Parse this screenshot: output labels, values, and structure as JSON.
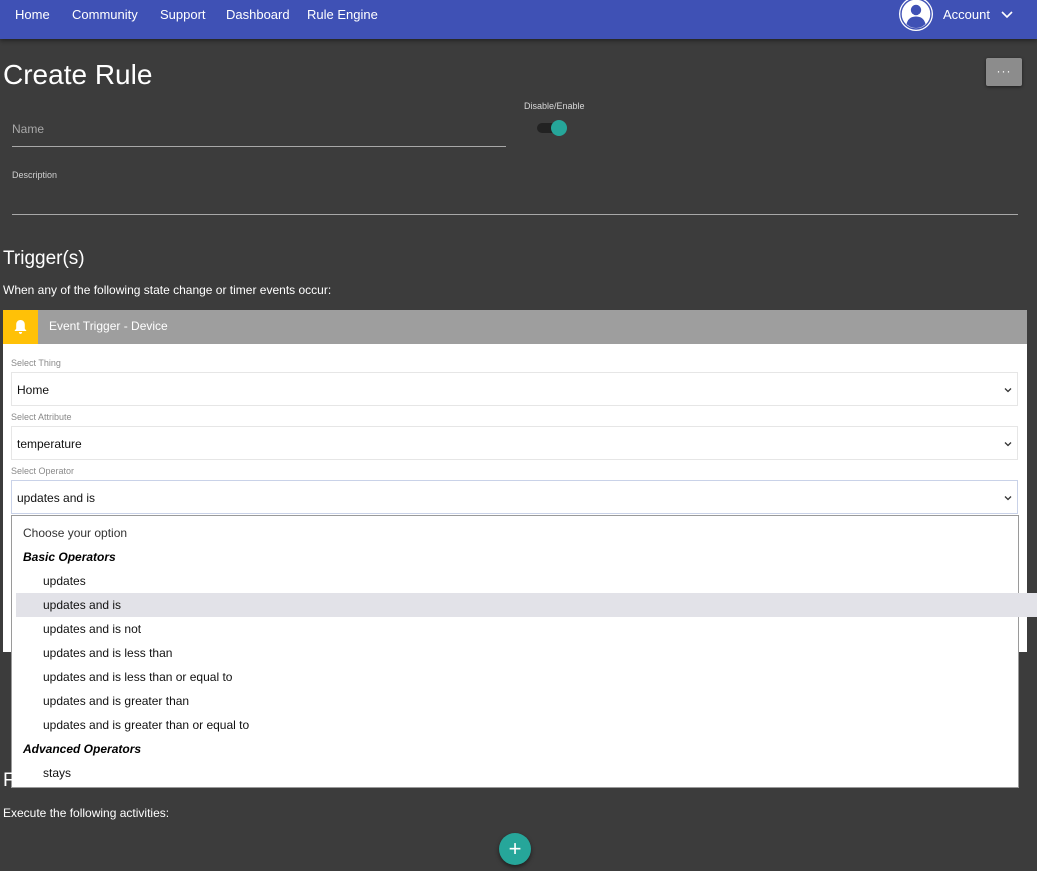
{
  "nav": {
    "items": [
      "Home",
      "Community",
      "Support",
      "Dashboard",
      "Rule Engine"
    ],
    "account_label": "Account",
    "bg_color": "#3f51b5"
  },
  "header": {
    "title": "Create Rule",
    "more_label": "···"
  },
  "form": {
    "name_placeholder": "Name",
    "toggle_label": "Disable/Enable",
    "toggle_on": true,
    "description_label": "Description"
  },
  "triggers": {
    "title": "Trigger(s)",
    "subtitle": "When any of the following state change or timer events occur:",
    "card": {
      "title": "Event Trigger - Device",
      "icon": "bell-icon",
      "thing_label": "Select Thing",
      "thing_value": "Home",
      "attribute_label": "Select Attribute",
      "attribute_value": "temperature",
      "operator_label": "Select Operator",
      "operator_value": "updates and is"
    }
  },
  "operator_dropdown": {
    "prompt": "Choose your option",
    "basic_group": "Basic Operators",
    "basic_options": [
      "updates",
      "updates and is",
      "updates and is not",
      "updates and is less than",
      "updates and is less than or equal to",
      "updates and is greater than",
      "updates and is greater than or equal to"
    ],
    "selected": "updates and is",
    "advanced_group": "Advanced Operators",
    "advanced_options": [
      "stays"
    ]
  },
  "actions": {
    "title_stub": "F",
    "subtitle": "Execute the following activities:",
    "add_label": "+"
  },
  "colors": {
    "accent": "#26a69a",
    "trigger_icon": "#ffc107",
    "background": "#3c3c3c"
  }
}
